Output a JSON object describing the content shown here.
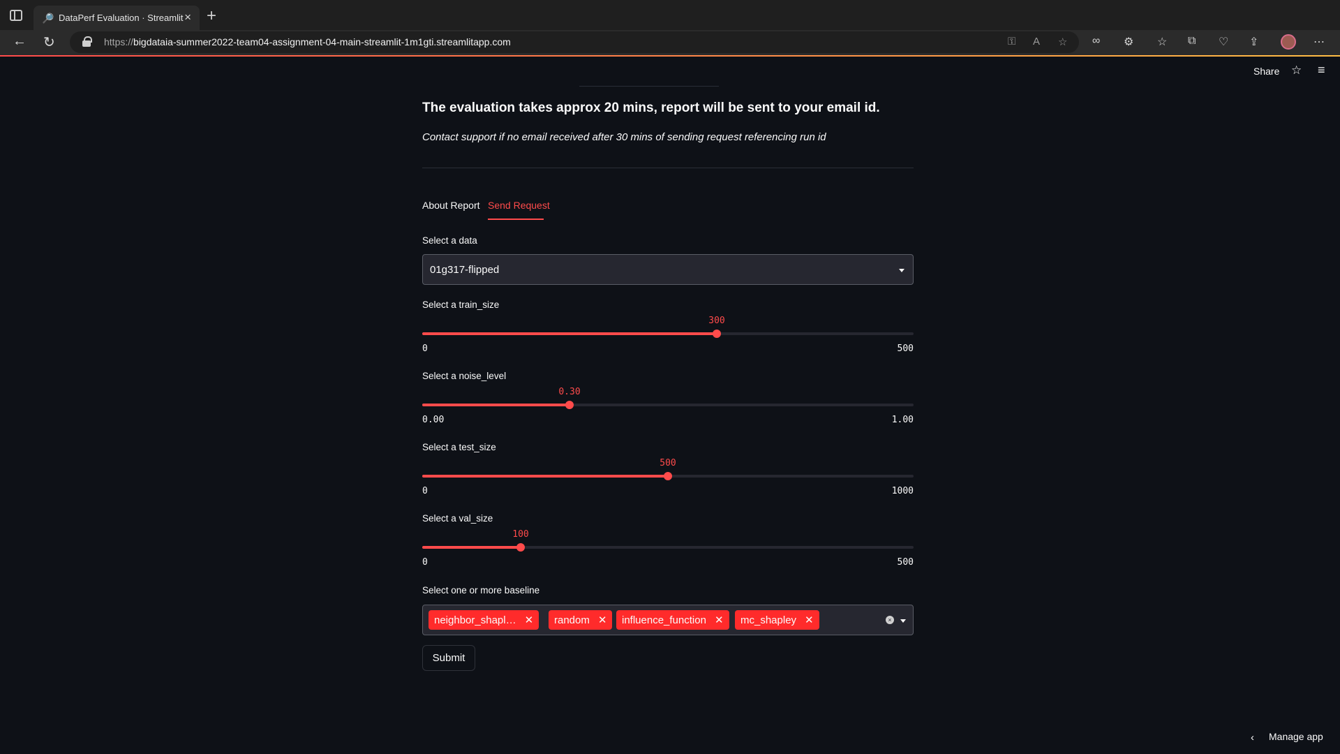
{
  "browser": {
    "tab_title": "DataPerf Evaluation · Streamlit",
    "url_prefix": "https://",
    "url_host": "bigdataia-summer2022-team04-assignment-04-main-streamlit-1m1gti.streamlitapp.com"
  },
  "header": {
    "share_label": "Share"
  },
  "page": {
    "heading": "The evaluation takes approx 20 mins, report will be sent to your email id.",
    "subtext": "Contact support if no email received after 30 mins of sending request referencing run id"
  },
  "tabs": [
    {
      "label": "About Report",
      "active": false
    },
    {
      "label": "Send Request",
      "active": true
    }
  ],
  "form": {
    "data_label": "Select a data",
    "data_value": "01g317-flipped",
    "train_size": {
      "label": "Select a train_size",
      "min": "0",
      "max": "500",
      "value": "300",
      "fraction": 0.6
    },
    "noise_level": {
      "label": "Select a noise_level",
      "min": "0.00",
      "max": "1.00",
      "value": "0.30",
      "fraction": 0.3
    },
    "test_size": {
      "label": "Select a test_size",
      "min": "0",
      "max": "1000",
      "value": "500",
      "fraction": 0.5
    },
    "val_size": {
      "label": "Select a val_size",
      "min": "0",
      "max": "500",
      "value": "100",
      "fraction": 0.2
    },
    "baseline_label": "Select one or more baseline",
    "baselines": [
      "neighbor_shapl…",
      "random",
      "influence_function",
      "mc_shapley"
    ],
    "submit_label": "Submit"
  },
  "footer": {
    "manage_label": "Manage app"
  },
  "colors": {
    "accent": "#ff4b4b",
    "background": "#0e1117",
    "input_bg": "#262730"
  },
  "icons": [
    "sidebar-icon",
    "close-icon",
    "plus-icon",
    "back-icon",
    "reload-icon",
    "lock-icon",
    "key-icon",
    "read-aloud-icon",
    "add-favorite-icon",
    "glasses-icon",
    "extensions-icon",
    "favorites-icon",
    "collections-icon",
    "performance-icon",
    "share-icon",
    "more-icon",
    "star-icon",
    "hamburger-icon",
    "chevron-down-icon",
    "chevron-left-icon"
  ]
}
